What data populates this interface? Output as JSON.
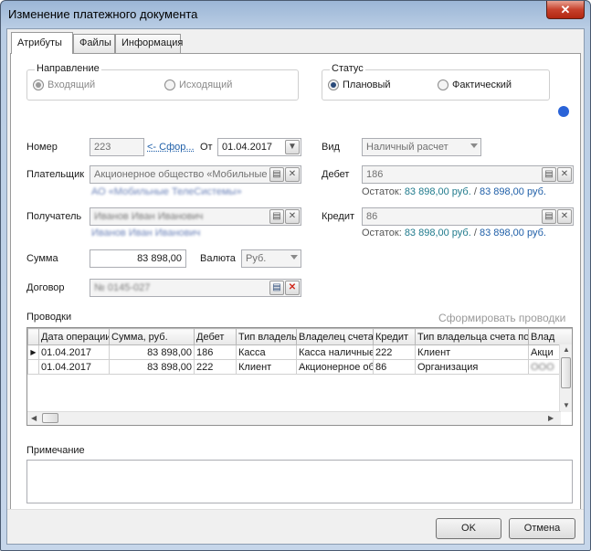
{
  "window": {
    "title": "Изменение платежного документа",
    "close_glyph": "✕"
  },
  "tabs": [
    {
      "label": "Атрибуты",
      "active": true
    },
    {
      "label": "Файлы",
      "active": false
    },
    {
      "label": "Информация",
      "active": false
    }
  ],
  "direction": {
    "title": "Направление",
    "options": [
      {
        "label": "Входящий",
        "checked": true,
        "disabled": true
      },
      {
        "label": "Исходящий",
        "checked": false,
        "disabled": true
      }
    ]
  },
  "status": {
    "title": "Статус",
    "options": [
      {
        "label": "Плановый",
        "checked": true
      },
      {
        "label": "Фактический",
        "checked": false
      }
    ],
    "indicator_color": "#2a63d8"
  },
  "fields": {
    "number_label": "Номер",
    "number_value": "223",
    "number_link": "<- Сфор...",
    "date_label": "От",
    "date_value": "01.04.2017",
    "kind_label": "Вид",
    "kind_value": "Наличный расчет",
    "payer_label": "Плательщик",
    "payer_value": "Акционерное общество «Мобильные",
    "payer_sub": "АО «Мобильные ТелеСистемы»",
    "debit_label": "Дебет",
    "debit_value": "186",
    "debit_balance_label": "Остаток:",
    "debit_balance_1": "83 898,00 руб.",
    "debit_balance_sep": "/",
    "debit_balance_2": "83 898,00 руб.",
    "recipient_label": "Получатель",
    "recipient_value": "Иванов Иван Иванович",
    "recipient_sub": "Иванов Иван Иванович",
    "credit_label": "Кредит",
    "credit_value": "86",
    "credit_balance_label": "Остаток:",
    "credit_balance_1": "83 898,00 руб.",
    "credit_balance_sep": "/",
    "credit_balance_2": "83 898,00 руб.",
    "sum_label": "Сумма",
    "sum_value": "83 898,00",
    "currency_label": "Валюта",
    "currency_value": "Руб.",
    "contract_label": "Договор",
    "contract_value": "№ 0145-027"
  },
  "postings": {
    "title": "Проводки",
    "generate_label": "Сформировать проводки",
    "columns": [
      "Дата операции",
      "Сумма, руб.",
      "Дебет",
      "Тип владельца",
      "Владелец счета",
      "Кредит",
      "Тип владельца счета по",
      "Влад"
    ],
    "rows": [
      {
        "current": true,
        "cells": [
          "01.04.2017",
          "83 898,00",
          "186",
          "Касса",
          "Касса наличные",
          "222",
          "Клиент",
          "Акци"
        ]
      },
      {
        "current": false,
        "cells": [
          "01.04.2017",
          "83 898,00",
          "222",
          "Клиент",
          "Акционерное об",
          "86",
          "Организация",
          "ООО"
        ]
      }
    ]
  },
  "note": {
    "label": "Примечание",
    "value": ""
  },
  "buttons": {
    "ok": "OK",
    "cancel": "Отмена"
  },
  "icons": {
    "ellipsis": "▤",
    "clear": "✕",
    "dropdown": "▼",
    "row_pointer": "▶",
    "scroll_up": "▲",
    "scroll_down": "▼",
    "scroll_left": "◀",
    "scroll_right": "▶"
  }
}
